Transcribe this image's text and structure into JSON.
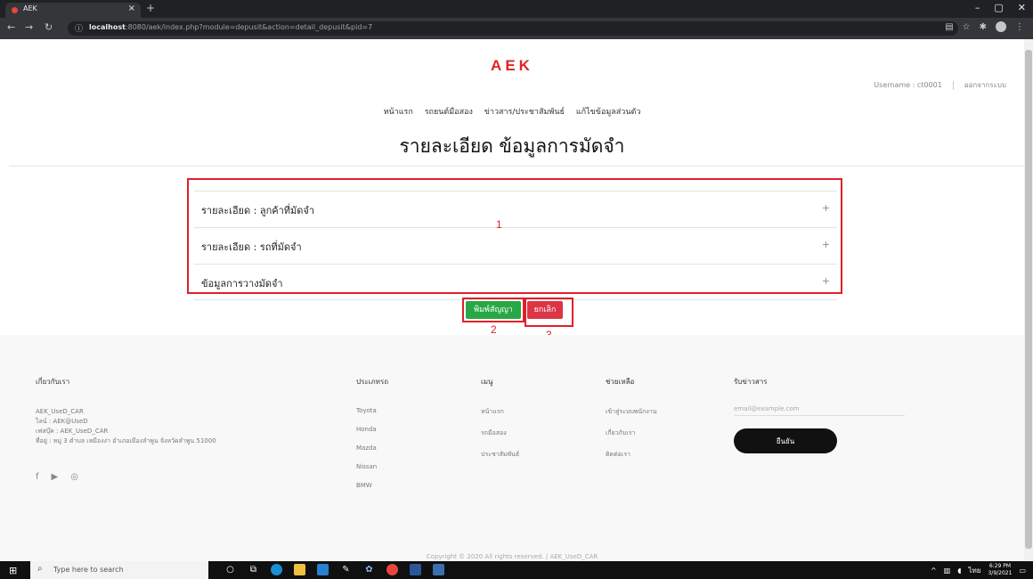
{
  "browser": {
    "tab_title": "AEK",
    "tab_close": "×",
    "new_tab": "+",
    "url_host": "localhost",
    "url_rest": ":8080/aek/index.php?module=depusit&action=detail_depusit&pid=7",
    "min_glyph": "–",
    "max_glyph": "▢",
    "close_glyph": "✕"
  },
  "header": {
    "logo": "AEK",
    "username_label": "Username : ct0001",
    "logout_label": "ออกจากระบบ",
    "nav": [
      "หน้าแรก",
      "รถยนต์มือสอง",
      "ข่าวสาร/ประชาสัมพันธ์",
      "แก้ไขข้อมูลส่วนตัว"
    ]
  },
  "page": {
    "title": "รายละเอียด ข้อมูลการมัดจำ",
    "sections": [
      {
        "label": "รายละเอียด : ลูกค้าที่มัดจำ",
        "toggle": "+"
      },
      {
        "label": "รายละเอียด : รถที่มัดจำ",
        "toggle": "+"
      },
      {
        "label": "ข้อมูลการวางมัดจำ",
        "toggle": "+"
      }
    ],
    "print_button": "พิมพ์สัญญา",
    "cancel_button": "ยกเลิก"
  },
  "annotations": [
    "1",
    "2",
    "3"
  ],
  "footer": {
    "about": {
      "heading": "เกี่ยวกับเรา",
      "lines": [
        "AEK_UseD_CAR",
        "ไลน์ : AEK@UseD",
        "เฟสบุ๊ค : AEK_UseD_CAR",
        "ที่อยู่ : หมู่ 3 ตำบล เหมืองง่า อำเภอเมืองลำพูน จังหวัดลำพูน 51000"
      ]
    },
    "brands": {
      "heading": "ประเภทรถ",
      "items": [
        "Toyota",
        "Honda",
        "Mazda",
        "Nissan",
        "BMW"
      ]
    },
    "menu": {
      "heading": "เมนู",
      "items": [
        "หน้าแรก",
        "รถมือสอง",
        "ประชาสัมพันธ์"
      ]
    },
    "help": {
      "heading": "ช่วยเหลือ",
      "items": [
        "เข้าสู่ระบบพนักงาน",
        "เกี่ยวกับเรา",
        "ติดต่อเรา"
      ]
    },
    "newsletter": {
      "heading": "รับข่าวสาร",
      "email_placeholder": "email@example.com",
      "submit": "ยืนยัน"
    },
    "social": [
      "facebook-icon",
      "youtube-icon",
      "instagram-icon"
    ],
    "copyright": "Copyright © 2020 All rights reserved. | AEK_UseD_CAR"
  },
  "taskbar": {
    "search_placeholder": "Type here to search",
    "lang": "ไทย",
    "time": "6:29 PM",
    "date": "3/9/2021"
  }
}
